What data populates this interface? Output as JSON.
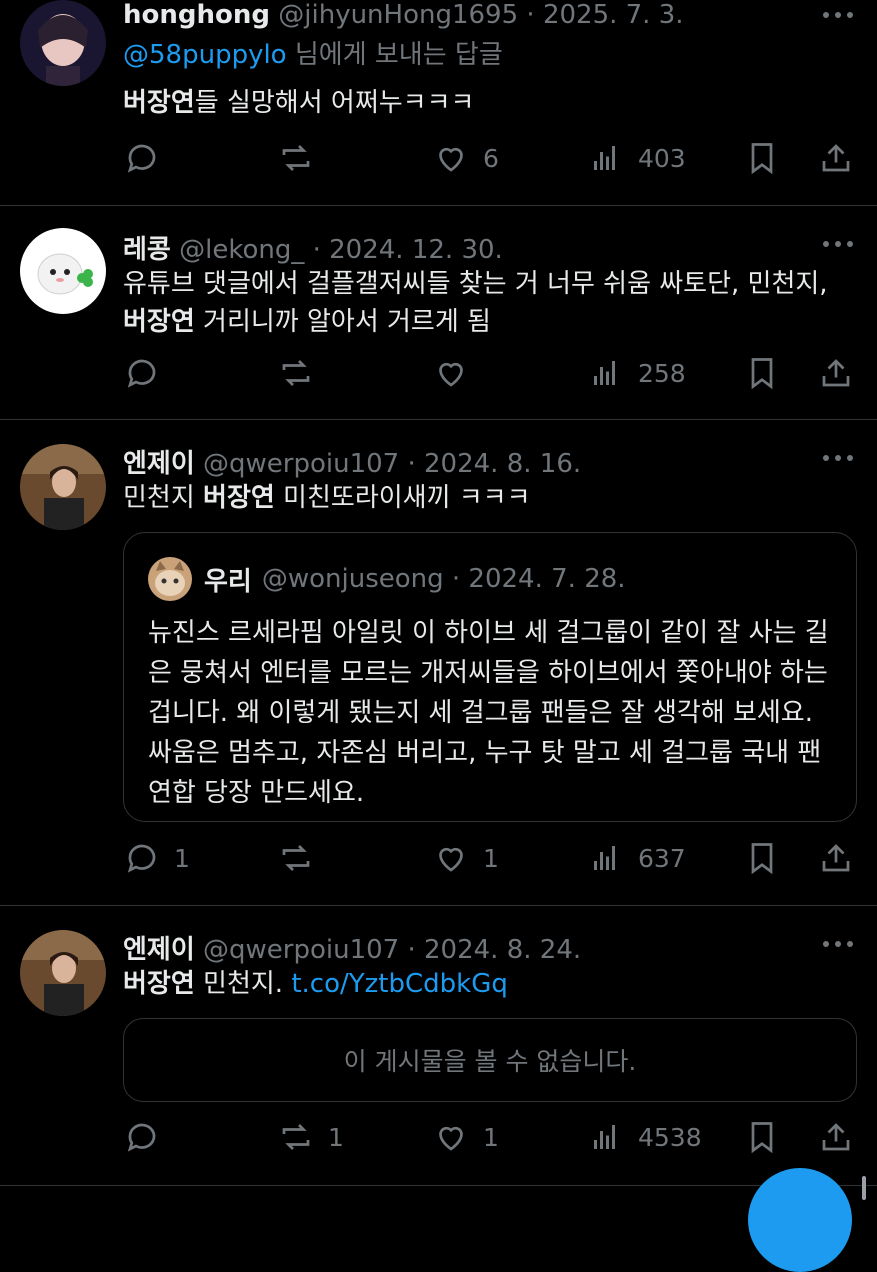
{
  "colors": {
    "background": "#000000",
    "text": "#e7e9ea",
    "muted": "#71767b",
    "link": "#1d9bf0",
    "border": "#2f3336"
  },
  "posts": [
    {
      "name": "honghong",
      "meta": "@jihyunHong1695 · 2025. 7. 3.",
      "reply_handle": "@58puppylo",
      "reply_suffix": " 님에게 보내는 답글",
      "text_bold": "버장연",
      "text_rest": "들 실망해서 어쩌누ㅋㅋㅋ",
      "replies": "",
      "reposts": "",
      "likes": "6",
      "views": "403"
    },
    {
      "name": "레콩",
      "meta": "@lekong_ · 2024. 12. 30.",
      "text_line1": "유튜브 댓글에서 걸플갤저씨들 찾는 거 너무 쉬움 싸토단, 민천지,",
      "text_bold": "버장연",
      "text_rest": " 거리니까 알아서 거르게 됨",
      "likes": "",
      "views": "258"
    },
    {
      "name": "엔제이",
      "meta": "@qwerpoiu107 · 2024. 8. 16.",
      "text_pre": "민천지 ",
      "text_bold": "버장연",
      "text_rest": " 미친또라이새끼 ㅋㅋㅋ",
      "quote": {
        "name": "우리",
        "meta": "@wonjuseong · 2024. 7. 28.",
        "text": "뉴진스 르세라핌 아일릿 이 하이브 세 걸그룹이 같이 잘 사는 길은 뭉쳐서 엔터를 모르는 개저씨들을 하이브에서 쫓아내야 하는겁니다. 왜 이렇게 됐는지 세 걸그룹 팬들은 잘 생각해 보세요. 싸움은 멈추고, 자존심 버리고, 누구 탓 말고 세 걸그룹 국내 팬 연합 당장 만드세요."
      },
      "replies": "1",
      "likes": "1",
      "views": "637"
    },
    {
      "name": "엔제이",
      "meta": "@qwerpoiu107 · 2024. 8. 24.",
      "text_bold": "버장연",
      "text_rest": " 민천지. ",
      "link": "t.co/YztbCdbkGq",
      "unavailable": "이 게시물을 볼 수 없습니다.",
      "reposts": "1",
      "likes": "1",
      "views": "4538"
    }
  ],
  "icons": [
    "reply-icon",
    "repost-icon",
    "like-icon",
    "views-icon",
    "bookmark-icon",
    "share-icon",
    "more-icon"
  ]
}
